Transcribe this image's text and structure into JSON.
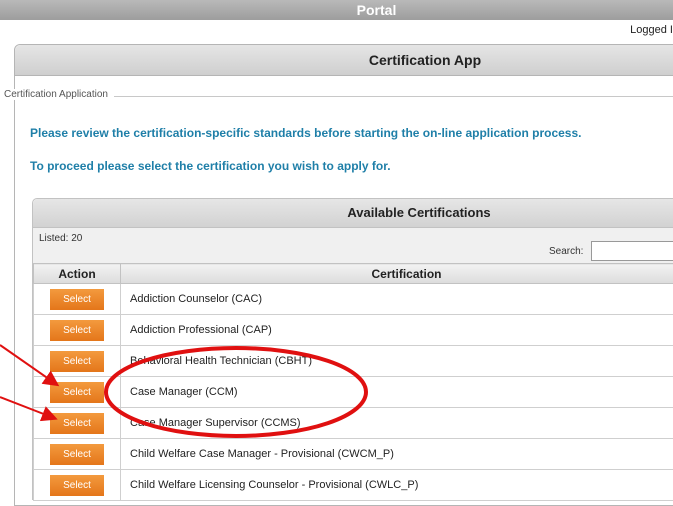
{
  "header": {
    "portal_title": "Portal",
    "logged_text": "Logged I"
  },
  "app": {
    "title": "Certification App",
    "legend": "Certification Application",
    "message1": "Please review the certification-specific standards before starting the on-line application process.",
    "message2": "To proceed please select the certification you wish to apply for."
  },
  "available": {
    "title": "Available Certifications",
    "listed": "Listed: 20",
    "search_label": "Search:",
    "search_value": "",
    "columns": [
      "Action",
      "Certification"
    ],
    "rows": [
      {
        "action": "Select",
        "name": "Addiction Counselor (CAC)"
      },
      {
        "action": "Select",
        "name": "Addiction Professional (CAP)"
      },
      {
        "action": "Select",
        "name": "Behavioral Health Technician (CBHT)"
      },
      {
        "action": "Select",
        "name": "Case Manager (CCM)"
      },
      {
        "action": "Select",
        "name": "Case Manager Supervisor (CCMS)"
      },
      {
        "action": "Select",
        "name": "Child Welfare Case Manager - Provisional (CWCM_P)"
      },
      {
        "action": "Select",
        "name": "Child Welfare Licensing Counselor - Provisional (CWLC_P)"
      }
    ]
  },
  "colors": {
    "accent": "#1f7fa8",
    "button": "#ee8a2e",
    "annotation": "#e01010"
  }
}
